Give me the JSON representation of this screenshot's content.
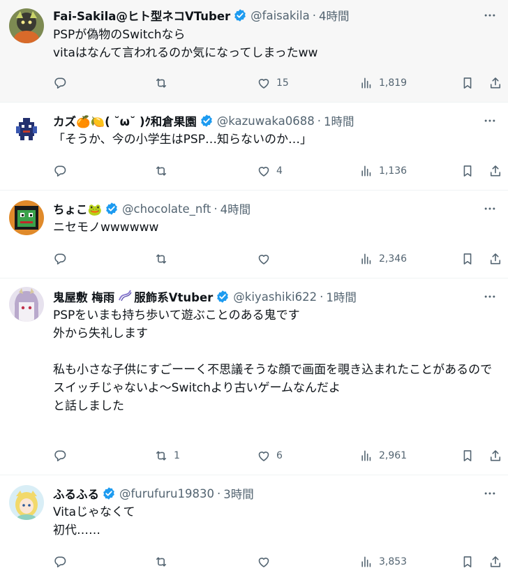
{
  "tweets": [
    {
      "name": "Fai-Sakila@ヒト型ネコVTuber",
      "handle": "@faisakila",
      "time": "4時間",
      "text": "PSPが偽物のSwitchなら\nvitaはなんて言われるのか気になってしまったww",
      "replies": "",
      "retweets": "",
      "likes": "15",
      "views": "1,819"
    },
    {
      "name": "カズ🍊🍋( ˘ω˘ )ｸ和倉果園",
      "handle": "@kazuwaka0688",
      "time": "1時間",
      "text": "「そうか、今の小学生はPSP…知らないのか…」",
      "replies": "",
      "retweets": "",
      "likes": "4",
      "views": "1,136"
    },
    {
      "name": "ちょこ🐸",
      "handle": "@chocolate_nft",
      "time": "4時間",
      "text": "ニセモノwwwwww",
      "replies": "",
      "retweets": "",
      "likes": "",
      "views": "2,346"
    },
    {
      "name": "鬼屋敷 梅雨",
      "name_suffix": "服飾系Vtuber",
      "handle": "@kiyashiki622",
      "time": "1時間",
      "text": "PSPをいまも持ち歩いて遊ぶことのある鬼です\n外から失礼します\n\n私も小さな子供にすごーーく不思議そうな顔で画面を覗き込まれたことがあるので\nスイッチじゃないよ〜Switchより古いゲームなんだよ\nと話しました",
      "replies": "",
      "retweets": "1",
      "likes": "6",
      "views": "2,961"
    },
    {
      "name": "ふるふる",
      "handle": "@furufuru19830",
      "time": "3時間",
      "text": "Vitaじゃなくて\n初代……",
      "replies": "",
      "retweets": "",
      "likes": "",
      "views": "3,853"
    }
  ],
  "separator": "·",
  "colors": {
    "verified": "#1d9bf0",
    "muted": "#536471",
    "highlight_bg": "#f7f7f7"
  },
  "icons": [
    "reply-icon",
    "retweet-icon",
    "like-icon",
    "views-icon",
    "bookmark-icon",
    "share-icon",
    "more-icon",
    "verified-badge-icon"
  ]
}
